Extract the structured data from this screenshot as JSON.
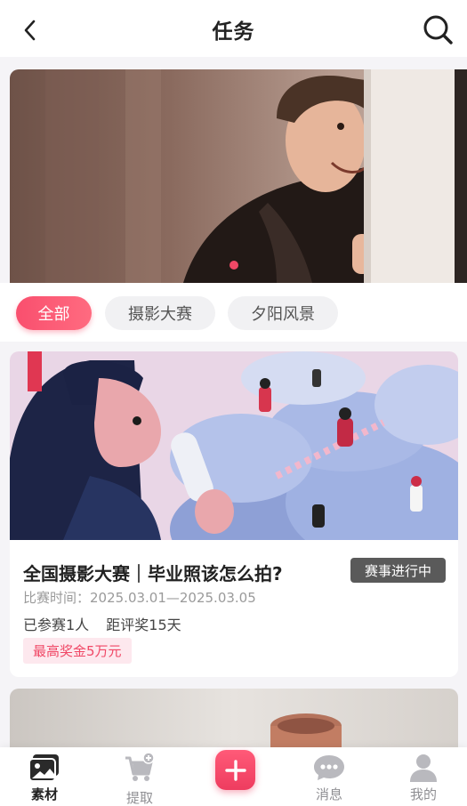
{
  "header": {
    "title": "任务",
    "back_icon": "chevron-left-icon",
    "search_icon": "search-icon"
  },
  "banner": {
    "slide_count": 1,
    "active_index": 0
  },
  "filters": {
    "items": [
      "全部",
      "摄影大赛",
      "夕阳风景"
    ],
    "selected": "全部"
  },
  "task_card": {
    "title": "全国摄影大赛｜毕业照该怎么拍?",
    "status": "赛事进行中",
    "date": "比赛时间：2025.03.01—2025.03.05",
    "participants": "已参赛1人",
    "countdown": "距评奖15天",
    "prize": "最高奖金5万元"
  },
  "bottom_nav": {
    "items": [
      {
        "label": "素材",
        "icon": "gallery-icon"
      },
      {
        "label": "提取",
        "icon": "cart-add-icon"
      },
      {
        "label": "",
        "icon": "plus-icon"
      },
      {
        "label": "消息",
        "icon": "chat-bubble-icon"
      },
      {
        "label": "我的",
        "icon": "user-icon"
      }
    ],
    "active": "素材"
  },
  "colors": {
    "accent": "#f04866",
    "accent_light": "#fde8ee",
    "badge_dark": "#5a5a5a",
    "background": "#f5f4f7"
  }
}
